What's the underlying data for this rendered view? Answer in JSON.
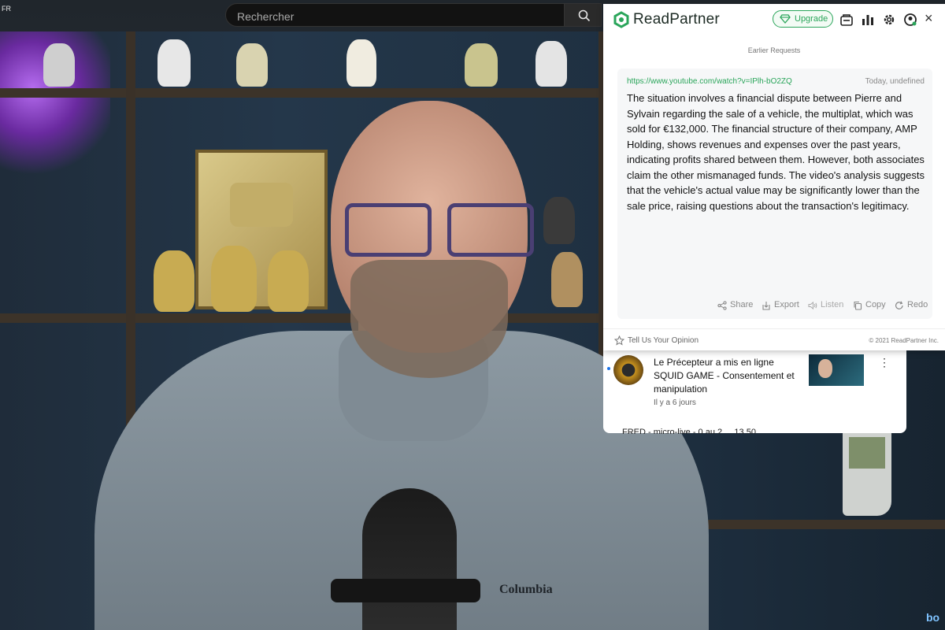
{
  "topbar": {
    "language_badge": "FR",
    "search_placeholder": "Rechercher"
  },
  "video": {
    "shirt_brand": "Columbia"
  },
  "readpartner": {
    "app_name": "ReadPartner",
    "upgrade_label": "Upgrade",
    "earlier_requests": "Earlier Requests",
    "url": "https://www.youtube.com/watch?v=IPlh-bO2ZQ",
    "date": "Today, undefined",
    "summary": "The situation involves a financial dispute between Pierre and Sylvain regarding the sale of a vehicle, the multiplat, which was sold for €132,000. The financial structure of their company, AMP Holding, shows revenues and expenses over the past years, indicating profits shared between them. However, both associates claim the other mismanaged funds. The video's analysis suggests that the vehicle's actual value may be significantly lower than the sale price, raising questions about the transaction's legitimacy.",
    "actions": {
      "share": "Share",
      "export": "Export",
      "listen": "Listen",
      "copy": "Copy",
      "redo": "Redo"
    },
    "feedback_label": "Tell Us Your Opinion",
    "copyright": "© 2021 ReadPartner Inc.",
    "accent_color": "#2aa55a"
  },
  "youtube_item": {
    "title": "Le Précepteur a mis en ligne SQUID GAME - Consentement et manipulation",
    "time": "Il y a 6 jours",
    "next_title": "FRED - micro-live - 0 au 2 ... 13 50"
  },
  "corner_badge": "bo"
}
